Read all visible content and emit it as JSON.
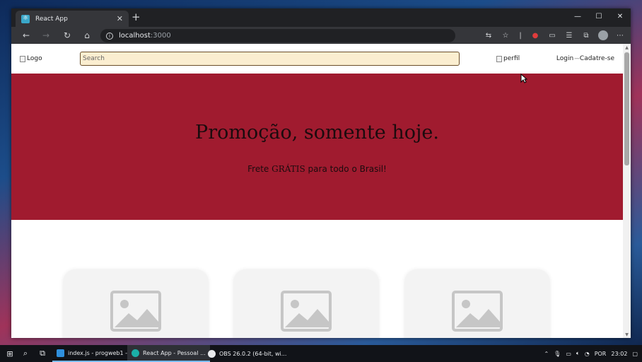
{
  "browser": {
    "tab_title": "React App",
    "tab_close": "✕",
    "new_tab": "+",
    "url_host": "localhost",
    "url_port": ":3000",
    "window_controls": {
      "minimize": "—",
      "maximize": "☐",
      "close": "✕"
    }
  },
  "header": {
    "logo_alt": "Logo",
    "search_placeholder": "Search",
    "perfil_alt": "perfil",
    "login_label": "Login",
    "separator": "---",
    "cadastre_label": "Cadatre-se"
  },
  "promo": {
    "title": "Promoção, somente hoje.",
    "subtitle_before": "Frete ",
    "subtitle_emph": "GRÁTIS",
    "subtitle_after": " para todo o Brasil!",
    "background": "#a01b2f"
  },
  "products": [
    {
      "icon": "image-placeholder-icon"
    },
    {
      "icon": "image-placeholder-icon"
    },
    {
      "icon": "image-placeholder-icon"
    }
  ],
  "taskbar": {
    "apps": [
      {
        "label": "index.js - progweb1 - ...",
        "icon": "vscode-icon"
      },
      {
        "label": "React App - Pessoal ...",
        "icon": "edge-icon"
      },
      {
        "label": "OBS 26.0.2 (64-bit, wi...",
        "icon": "obs-icon"
      }
    ],
    "language": "POR",
    "time": "23:02"
  }
}
